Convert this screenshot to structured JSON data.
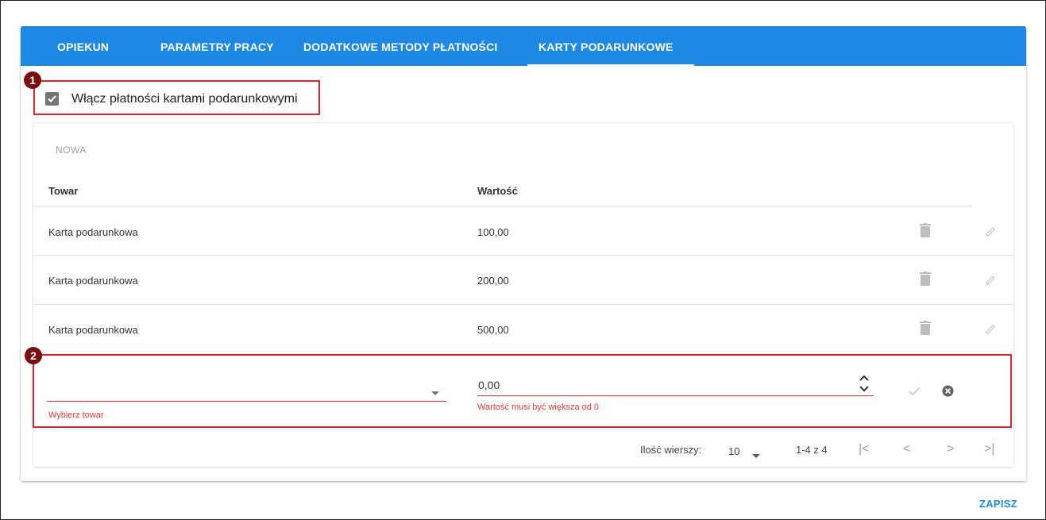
{
  "tabs": [
    {
      "label": "OPIEKUN"
    },
    {
      "label": "PARAMETRY PRACY"
    },
    {
      "label": "DODATKOWE METODY PŁATNOŚCI"
    },
    {
      "label": "KARTY PODARUNKOWE",
      "active": true
    }
  ],
  "annotations": {
    "badge1": "1",
    "badge2": "2"
  },
  "gift_cards": {
    "enable_label": "Włącz płatności kartami podarunkowymi",
    "enabled": true,
    "new_button": "NOWA",
    "columns": {
      "product": "Towar",
      "value": "Wartość"
    },
    "rows": [
      {
        "product": "Karta podarunkowa",
        "value": "100,00"
      },
      {
        "product": "Karta podarunkowa",
        "value": "200,00"
      },
      {
        "product": "Karta podarunkowa",
        "value": "500,00"
      }
    ],
    "new_row": {
      "product_value": "",
      "product_error": "Wybierz towar",
      "value": "0,00",
      "value_error": "Wartość musi być większa od 0"
    },
    "pager": {
      "rows_label": "Ilość wierszy:",
      "rows_value": "10",
      "range": "1-4 z 4"
    }
  },
  "footer": {
    "save_label": "ZAPISZ"
  },
  "colors": {
    "accent": "#1e88e5",
    "error": "#e53935",
    "annotation": "#e0252b",
    "badge": "#7a0d0d"
  }
}
